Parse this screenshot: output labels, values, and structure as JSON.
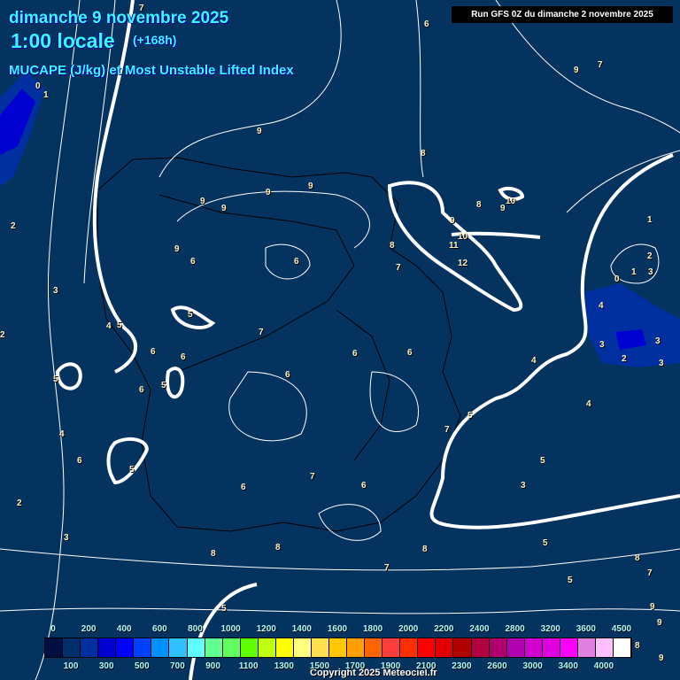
{
  "header": {
    "date": "dimanche 9 novembre 2025",
    "time": "1:00 locale",
    "lead": "(+168h)",
    "parameter": "MUCAPE (J/kg) et Most Unstable Lifted Index",
    "run": "Run GFS 0Z du dimanche 2 novembre 2025"
  },
  "legend": {
    "top_labels": [
      "0",
      "200",
      "400",
      "600",
      "800",
      "1000",
      "1200",
      "1400",
      "1600",
      "1800",
      "2000",
      "2200",
      "2400",
      "2800",
      "3200",
      "3600",
      "4500"
    ],
    "bottom_labels": [
      "100",
      "300",
      "500",
      "700",
      "900",
      "1100",
      "1300",
      "1500",
      "1700",
      "1900",
      "2100",
      "2300",
      "2600",
      "3000",
      "3400",
      "4000"
    ],
    "colors": [
      "#000f40",
      "#00306a",
      "#0030a0",
      "#0000d0",
      "#0000ff",
      "#0040ff",
      "#0090ff",
      "#30c0ff",
      "#60ffff",
      "#60ff90",
      "#60ff60",
      "#60ff00",
      "#c0ff10",
      "#ffff00",
      "#ffff80",
      "#ffe050",
      "#ffc800",
      "#ffa000",
      "#ff6400",
      "#ff3c3c",
      "#ff3000",
      "#ff0000",
      "#e00000",
      "#b00000",
      "#b00040",
      "#b00070",
      "#b000b0",
      "#d000d0",
      "#e000e0",
      "#ff00ff",
      "#e080e0",
      "#ffc0ff",
      "#ffffff"
    ]
  },
  "contour_labels": [
    "7",
    "6",
    "9",
    "7",
    "0",
    "1",
    "9",
    "8",
    "2",
    "9",
    "9",
    "9",
    "9",
    "9",
    "6",
    "8",
    "7",
    "10",
    "9",
    "10",
    "8",
    "9",
    "11",
    "12",
    "3",
    "6",
    "5",
    "4",
    "5",
    "6",
    "7",
    "6",
    "6",
    "6",
    "6",
    "5",
    "5",
    "4",
    "6",
    "5",
    "7",
    "6",
    "7",
    "6",
    "6",
    "5",
    "4",
    "3",
    "2",
    "8",
    "8",
    "7",
    "8",
    "5",
    "1",
    "0",
    "1",
    "2",
    "3",
    "4",
    "2",
    "3",
    "3",
    "5",
    "5",
    "3",
    "4",
    "2",
    "3",
    "5",
    "8",
    "7",
    "9",
    "9",
    "8",
    "9"
  ],
  "copyright": "Copyright 2025 Meteociel.fr"
}
